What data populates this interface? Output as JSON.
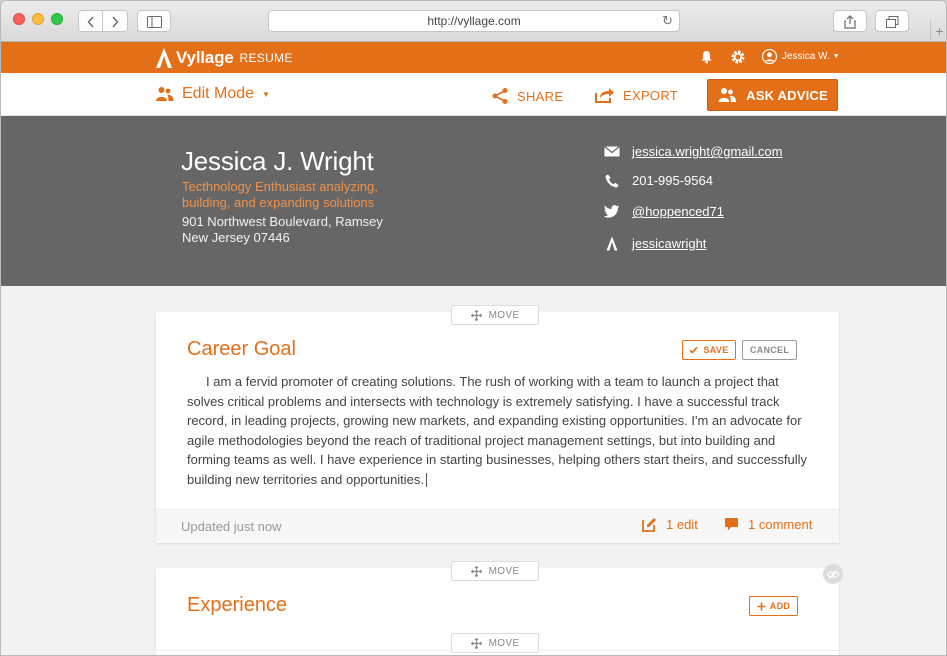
{
  "browser": {
    "url": "http://vyllage.com"
  },
  "appbar": {
    "brand": "Vyllage",
    "product": "RESUME",
    "user_name": "Jessica W."
  },
  "actionbar": {
    "mode_label": "Edit Mode",
    "share_label": "SHARE",
    "export_label": "EXPORT",
    "ask_label": "ASK ADVICE"
  },
  "profile": {
    "name": "Jessica J. Wright",
    "tagline": "Tecthnology Enthusiast analyzing, building, and expanding solutions",
    "address": "901 Northwest Boulevard, Ramsey New Jersey 07446",
    "email": "jessica.wright@gmail.com",
    "phone": "201-995-9564",
    "twitter": "@hoppenced71",
    "vyllage": "jessicawright"
  },
  "sections": {
    "move_label": "MOVE",
    "career": {
      "title": "Career Goal",
      "save_label": "SAVE",
      "cancel_label": "CANCEL",
      "body": "I am a fervid promoter of creating solutions. The rush of working with a team to launch a project that solves critical problems and intersects with technology is extremely satisfying. I have a successful track record, in leading projects, growing new markets, and expanding existing opportunities. I'm an advocate for agile methodologies beyond the reach of traditional project management settings, but into building and forming teams as well. I have experience in starting businesses, helping others start theirs, and successfully building new territories and opportunities.",
      "updated": "Updated just now",
      "edits": "1 edit",
      "comments": "1 comment"
    },
    "experience": {
      "title": "Experience",
      "add_label": "ADD"
    }
  },
  "colors": {
    "accent": "#e46f19",
    "header_bg": "#666666"
  }
}
